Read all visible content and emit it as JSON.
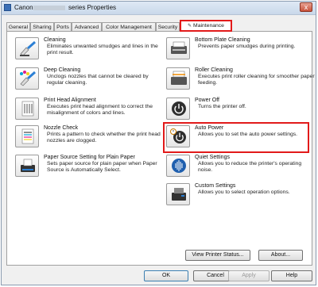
{
  "window": {
    "title_brand": "Canon",
    "title_rest": "series Properties",
    "close_glyph": "x"
  },
  "tabs": [
    {
      "label": "General"
    },
    {
      "label": "Sharing"
    },
    {
      "label": "Ports"
    },
    {
      "label": "Advanced"
    },
    {
      "label": "Color Management"
    },
    {
      "label": "Security"
    },
    {
      "label": "Maintenance",
      "icon": "tools-icon"
    }
  ],
  "left_items": [
    {
      "title": "Cleaning",
      "desc": "Eliminates unwanted smudges and lines in the print result.",
      "icon": "brush-cleaning-icon"
    },
    {
      "title": "Deep Cleaning",
      "desc": "Unclogs nozzles that cannot be cleared by regular cleaning.",
      "icon": "deep-cleaning-icon"
    },
    {
      "title": "Print Head Alignment",
      "desc": "Executes print head alignment to correct the misalignment of colors and lines.",
      "icon": "alignment-icon"
    },
    {
      "title": "Nozzle Check",
      "desc": "Prints a pattern to check whether the print head nozzles are clogged.",
      "icon": "nozzle-pattern-icon"
    },
    {
      "title": "Paper Source Setting for Plain Paper",
      "desc": "Sets paper source for plain paper when Paper Source is Automatically Select.",
      "icon": "paper-source-icon"
    }
  ],
  "right_items": [
    {
      "title": "Bottom Plate Cleaning",
      "desc": "Prevents paper smudges during printing.",
      "icon": "bottom-plate-icon"
    },
    {
      "title": "Roller Cleaning",
      "desc": "Executes print roller cleaning for smoother paper feeding.",
      "icon": "roller-icon"
    },
    {
      "title": "Power Off",
      "desc": "Turns the printer off.",
      "icon": "power-icon"
    },
    {
      "title": "Auto Power",
      "desc": "Allows you to set the auto power settings.",
      "icon": "auto-power-icon"
    },
    {
      "title": "Quiet Settings",
      "desc": "Allows you to reduce the printer's operating noise.",
      "icon": "quiet-sound-icon"
    },
    {
      "title": "Custom Settings",
      "desc": "Allows you to select operation options.",
      "icon": "custom-printer-icon"
    }
  ],
  "panel_buttons": {
    "view_status": "View Printer Status...",
    "about": "About..."
  },
  "dialog_buttons": {
    "ok": "OK",
    "cancel": "Cancel",
    "apply": "Apply",
    "help": "Help"
  },
  "colors": {
    "highlight": "#e21a1a"
  }
}
